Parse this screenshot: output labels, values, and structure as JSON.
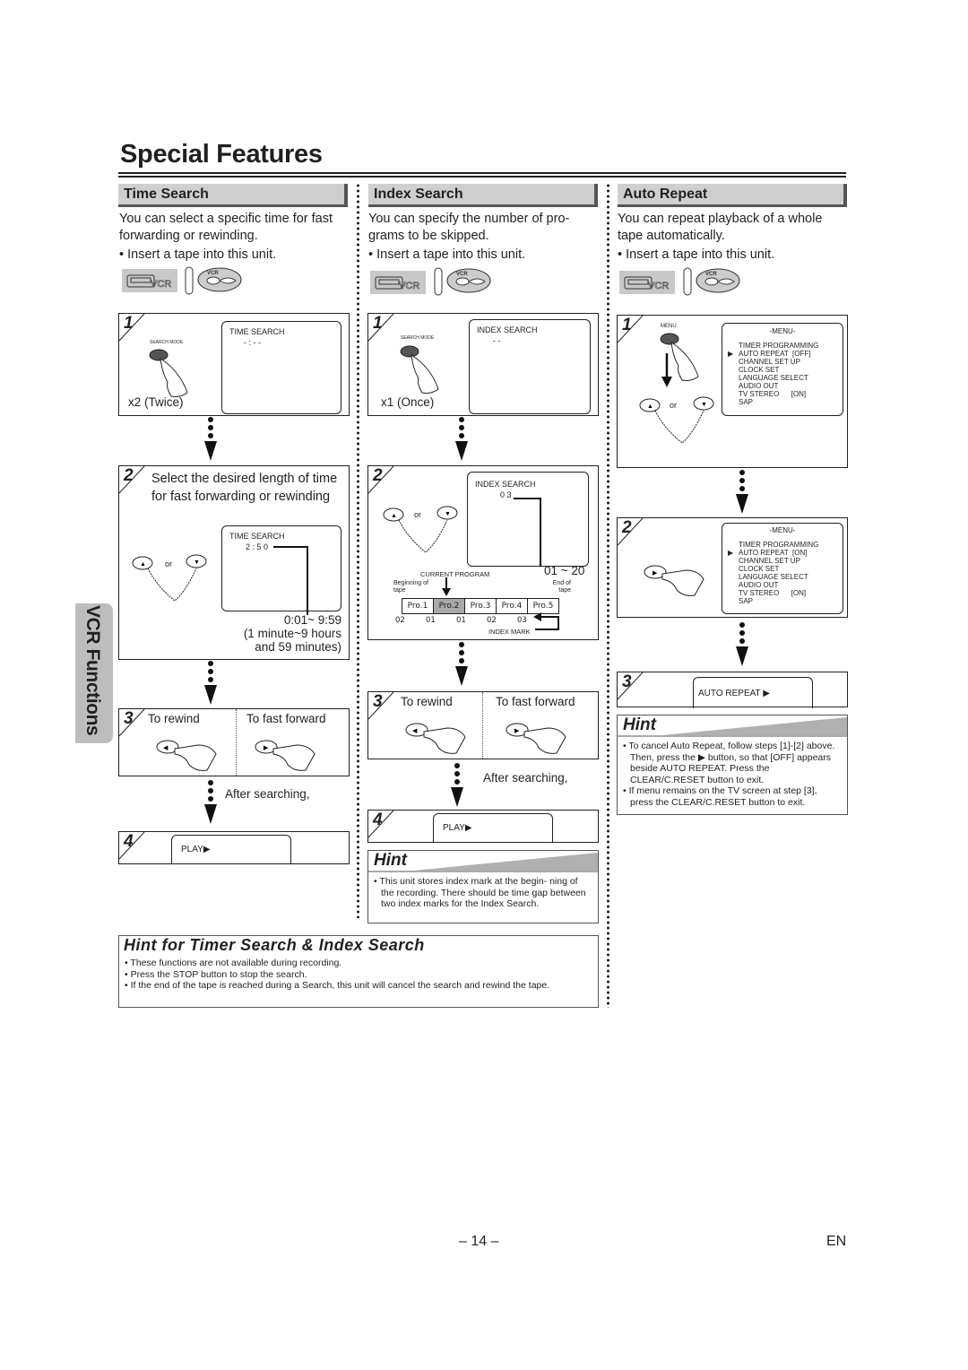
{
  "page": {
    "title": "Special Features",
    "side_tab": "VCR Functions",
    "page_number": "– 14 –",
    "language": "EN"
  },
  "sections": {
    "time_search": {
      "heading": "Time Search",
      "intro": "You can select a specific time for fast forwarding or rewinding.",
      "bullet": "• Insert a tape into this unit.",
      "step1": {
        "num": "1",
        "button_label": "SEARCH MODE",
        "screen_title": "TIME SEARCH",
        "screen_value": "- : - -",
        "press_count": "x2 (Twice)"
      },
      "step2": {
        "num": "2",
        "instruction": "Select the desired length of time for fast forwarding or rewinding",
        "screen_title": "TIME SEARCH",
        "screen_value": "2 : 5 0",
        "or": "or",
        "range": "0:01~ 9:59",
        "range_note1": "(1 minute~9 hours",
        "range_note2": "and 59 minutes)"
      },
      "step3": {
        "num": "3",
        "rewind": "To rewind",
        "fast_forward": "To fast forward"
      },
      "after": "After searching,",
      "step4": {
        "num": "4",
        "screen": "PLAY▶"
      }
    },
    "index_search": {
      "heading": "Index Search",
      "intro": "You can specify the number of pro- grams to be skipped.",
      "bullet": "• Insert a tape into this unit.",
      "step1": {
        "num": "1",
        "button_label": "SEARCH MODE",
        "screen_title": "INDEX SEARCH",
        "screen_value": "- -",
        "press_count": "x1 (Once)"
      },
      "step2": {
        "num": "2",
        "screen_title": "INDEX SEARCH",
        "screen_value": "0 3",
        "or": "or",
        "range": "01 ~ 20",
        "current_program": "CURRENT PROGRAM",
        "beginning": "Beginning of tape",
        "end": "End of tape",
        "programs": [
          "Pro.1",
          "Pro.2",
          "Pro.3",
          "Pro.4",
          "Pro.5"
        ],
        "current_index": 1,
        "marks": [
          "02",
          "01",
          "01",
          "02",
          "03"
        ],
        "index_mark": "INDEX MARK"
      },
      "step3": {
        "num": "3",
        "rewind": "To rewind",
        "fast_forward": "To fast forward"
      },
      "after": "After searching,",
      "step4": {
        "num": "4",
        "screen": "PLAY▶"
      },
      "hint": {
        "title": "Hint",
        "items": [
          "This unit stores index mark at the begin- ning of the recording. There should be time gap between two index marks for the Index Search."
        ]
      }
    },
    "auto_repeat": {
      "heading": "Auto Repeat",
      "intro": "You can repeat playback of a whole tape automatically.",
      "bullet": "• Insert a tape into this unit.",
      "step1": {
        "num": "1",
        "button_label": "MENU",
        "or": "or",
        "menu_title": "-MENU-",
        "menu_items": [
          "TIMER PROGRAMMING",
          "AUTO REPEAT  [OFF]",
          "CHANNEL SET UP",
          "CLOCK SET",
          "LANGUAGE SELECT",
          "AUDIO OUT",
          "TV STEREO      [ON]",
          "SAP"
        ],
        "selected": 1
      },
      "step2": {
        "num": "2",
        "menu_title": "-MENU-",
        "menu_items": [
          "TIMER PROGRAMMING",
          "AUTO REPEAT  [ON]",
          "CHANNEL SET UP",
          "CLOCK SET",
          "LANGUAGE SELECT",
          "AUDIO OUT",
          "TV STEREO      [ON]",
          "SAP"
        ],
        "selected": 1
      },
      "step3": {
        "num": "3",
        "screen": "AUTO REPEAT ▶"
      },
      "hint": {
        "title": "Hint",
        "items": [
          "To cancel Auto Repeat, follow steps [1]-[2] above. Then, press the ▶ button, so that [OFF] appears beside AUTO REPEAT. Press the CLEAR/C.RESET button to exit.",
          "If menu remains on the TV screen at step [3], press the CLEAR/C.RESET button to exit."
        ]
      }
    }
  },
  "common_hint": {
    "title": "Hint for Timer Search & Index Search",
    "items": [
      "These functions are not available during recording.",
      "Press the STOP button to stop the search.",
      "If the end of the tape is reached during a Search, this unit will cancel the search and rewind the tape."
    ]
  },
  "icons": {
    "vcr_badge": "VCR",
    "remote_vcr": "VCR"
  }
}
